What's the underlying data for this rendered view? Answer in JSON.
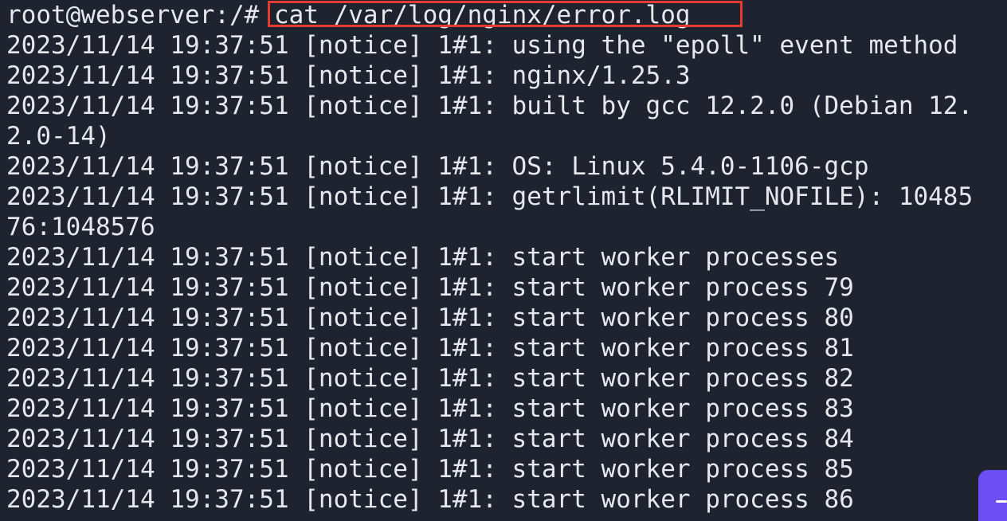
{
  "terminal": {
    "prompt": "root@webserver:/# ",
    "command": "cat /var/log/nginx/error.log",
    "lines": [
      "2023/11/14 19:37:51 [notice] 1#1: using the \"epoll\" event method",
      "2023/11/14 19:37:51 [notice] 1#1: nginx/1.25.3",
      "2023/11/14 19:37:51 [notice] 1#1: built by gcc 12.2.0 (Debian 12.",
      "2.0-14)",
      "2023/11/14 19:37:51 [notice] 1#1: OS: Linux 5.4.0-1106-gcp",
      "2023/11/14 19:37:51 [notice] 1#1: getrlimit(RLIMIT_NOFILE): 10485",
      "76:1048576",
      "2023/11/14 19:37:51 [notice] 1#1: start worker processes",
      "2023/11/14 19:37:51 [notice] 1#1: start worker process 79",
      "2023/11/14 19:37:51 [notice] 1#1: start worker process 80",
      "2023/11/14 19:37:51 [notice] 1#1: start worker process 81",
      "2023/11/14 19:37:51 [notice] 1#1: start worker process 82",
      "2023/11/14 19:37:51 [notice] 1#1: start worker process 83",
      "2023/11/14 19:37:51 [notice] 1#1: start worker process 84",
      "2023/11/14 19:37:51 [notice] 1#1: start worker process 85",
      "2023/11/14 19:37:51 [notice] 1#1: start worker process 86"
    ]
  },
  "colors": {
    "background": "#1f2330",
    "text": "#e6e8ee",
    "highlight_box": "#e53b30",
    "floating_button": "#6b4ff5"
  },
  "icons": {
    "floating_button_icon": "plus-icon"
  }
}
